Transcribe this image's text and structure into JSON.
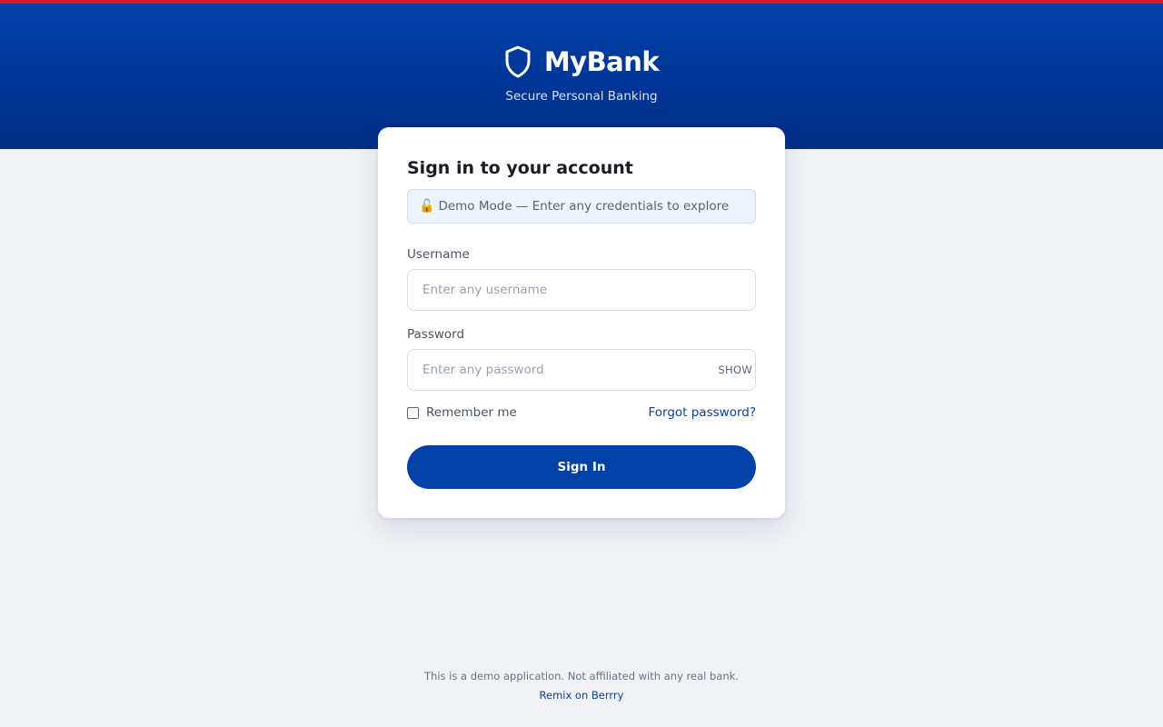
{
  "brand": {
    "name": "MyBank",
    "tagline": "Secure Personal Banking",
    "icon": "shield-icon"
  },
  "colors": {
    "top_strip": "#d7192a",
    "hero": "#003594",
    "primary": "#0241a8",
    "link": "#0b41a8",
    "background": "#f0f2f6"
  },
  "login": {
    "title": "Sign in to your account",
    "demo_banner": {
      "icon": "lock-open-icon",
      "icon_glyph": "🔓",
      "text": "Demo Mode — Enter any credentials to explore"
    },
    "username": {
      "label": "Username",
      "placeholder": "Enter any username",
      "value": ""
    },
    "password": {
      "label": "Password",
      "placeholder": "Enter any password",
      "value": "",
      "toggle_label": "SHOW"
    },
    "remember_me": {
      "label": "Remember me",
      "checked": false
    },
    "forgot_password": "Forgot password?",
    "submit_label": "Sign In"
  },
  "footer": {
    "note": "This is a demo application. Not affiliated with any real bank.",
    "link": "Remix on Berrry"
  }
}
